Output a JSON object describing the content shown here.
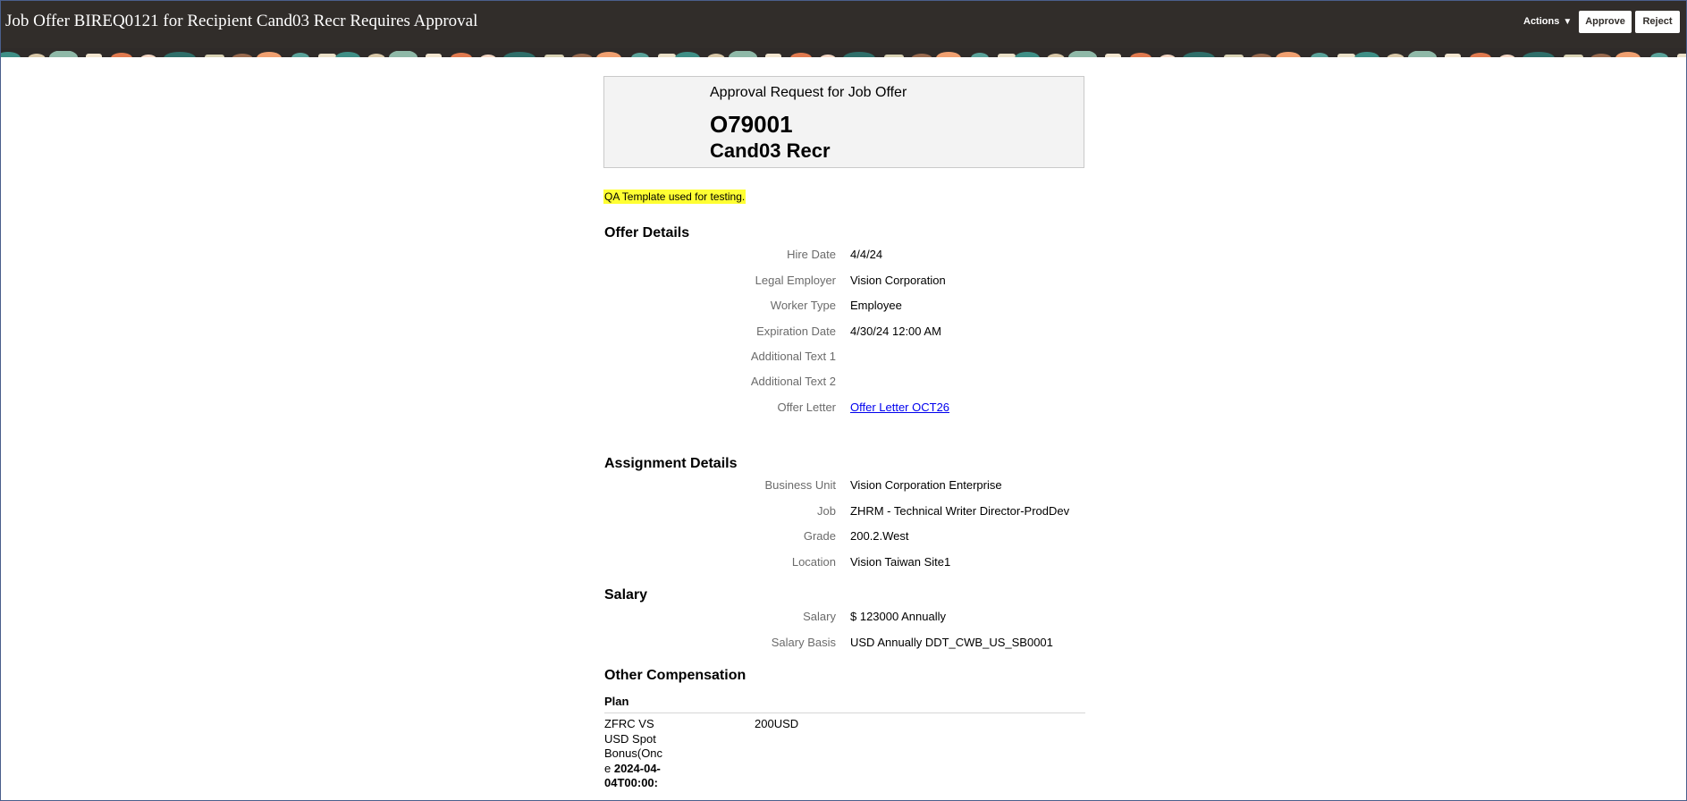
{
  "window": {
    "title": "Job Offer BIREQ0121 for Recipient Cand03 Recr Requires Approval"
  },
  "toolbar": {
    "actions_label": "Actions",
    "approve_label": "Approve",
    "reject_label": "Reject"
  },
  "card": {
    "subtitle": "Approval Request for Job Offer",
    "offer_id": "O79001",
    "candidate": "Cand03 Recr"
  },
  "note": "QA Template used for testing.",
  "offer_details": {
    "title": "Offer Details",
    "fields": [
      {
        "label": "Hire Date",
        "value": "4/4/24"
      },
      {
        "label": "Legal Employer",
        "value": "Vision Corporation"
      },
      {
        "label": "Worker Type",
        "value": "Employee"
      },
      {
        "label": "Expiration Date",
        "value": "4/30/24 12:00 AM"
      },
      {
        "label": "Additional Text 1",
        "value": ""
      },
      {
        "label": "Additional Text 2",
        "value": ""
      },
      {
        "label": "Offer Letter",
        "value": "Offer Letter OCT26"
      }
    ]
  },
  "assignment_details": {
    "title": "Assignment Details",
    "fields": [
      {
        "label": "Business Unit",
        "value": "Vision Corporation Enterprise"
      },
      {
        "label": "Job",
        "value": "ZHRM - Technical Writer Director-ProdDev"
      },
      {
        "label": "Grade",
        "value": "200.2.West"
      },
      {
        "label": "Location",
        "value": "Vision Taiwan Site1"
      }
    ]
  },
  "salary": {
    "title": "Salary",
    "fields": [
      {
        "label": "Salary",
        "value": "$ 123000 Annually"
      },
      {
        "label": "Salary Basis",
        "value": "USD Annually DDT_CWB_US_SB0001"
      }
    ]
  },
  "other_compensation": {
    "title": "Other Compensation",
    "plan_header": "Plan",
    "rows": [
      {
        "plan": "ZFRC VS USD Spot Bonus(Once ",
        "plan_date": "2024-04-04T00:00:",
        "amount": "200USD"
      }
    ]
  },
  "colors": {
    "header_bg": "#312d2a",
    "highlight": "#ffff33",
    "link": "#0000ee"
  }
}
